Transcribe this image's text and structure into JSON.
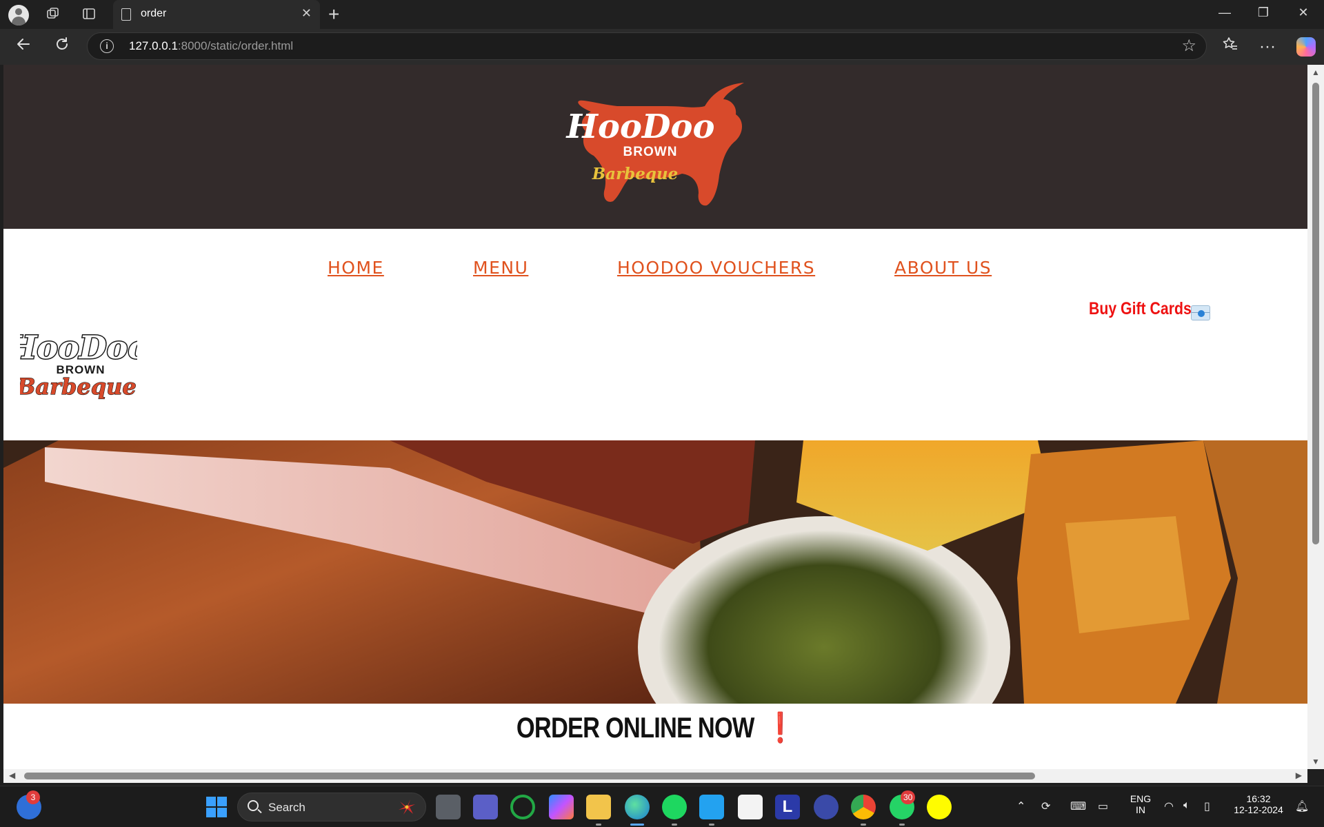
{
  "browser": {
    "tab_title": "order",
    "url_host": "127.0.0.1",
    "url_rest": ":8000/static/order.html"
  },
  "nav": {
    "home": "HOME",
    "menu": "MENU",
    "vouchers": "HOODOO VOUCHERS",
    "about": "ABOUT US"
  },
  "page": {
    "gift_cards": "Buy Gift Cards",
    "order_title": "ORDER ONLINE NOW",
    "order_mark": "❗"
  },
  "logo": {
    "brand_script": "HooDoo",
    "brand_word": "BROWN",
    "brand_sub": "Barbeque"
  },
  "taskbar": {
    "search_label": "Search",
    "copilot_badge": "3",
    "whatsapp_badge": "30",
    "lang_top": "ENG",
    "lang_bottom": "IN",
    "time": "16:32",
    "date": "12-12-2024"
  },
  "colors": {
    "header_band": "#332b2b",
    "nav_link": "#e0521e",
    "gift_cards": "#ee1111",
    "logo_cow": "#d84a2b",
    "logo_sub": "#e8c23c"
  }
}
